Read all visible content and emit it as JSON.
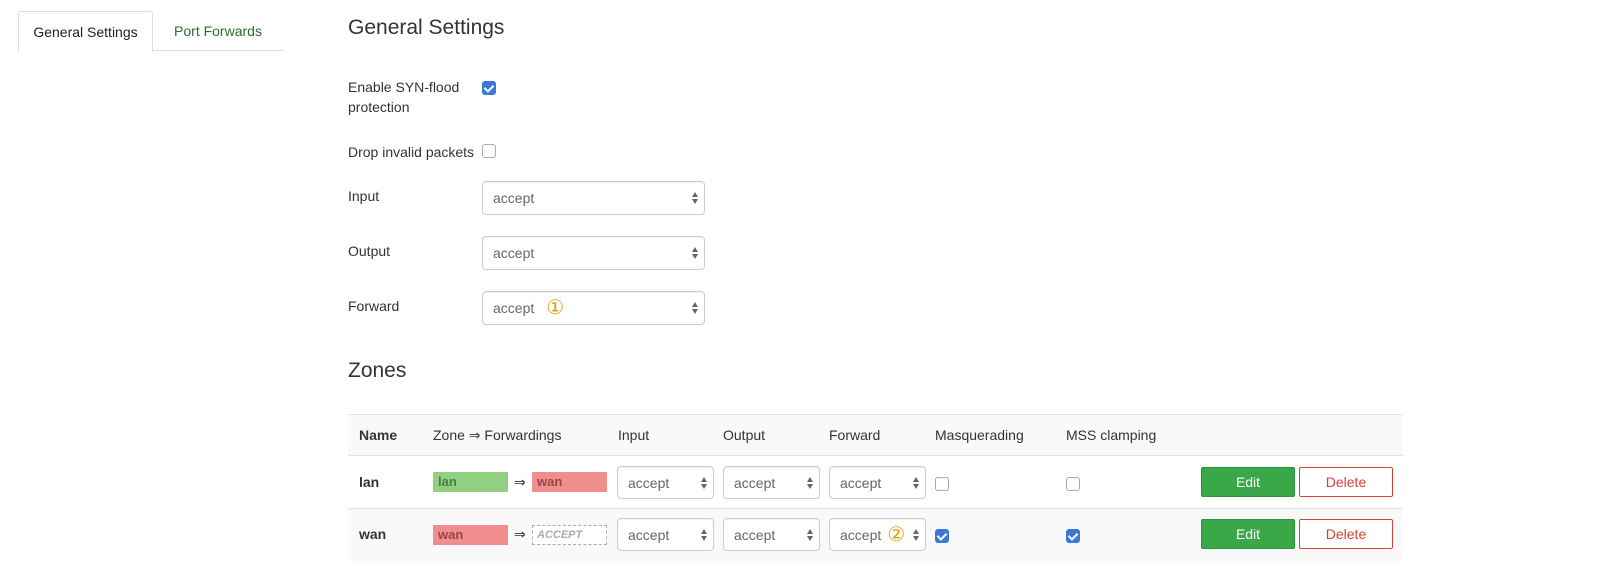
{
  "tabs": [
    {
      "label": "General Settings",
      "active": true
    },
    {
      "label": "Port Forwards",
      "active": false
    }
  ],
  "general": {
    "title": "General Settings",
    "syn_flood_label_line1": "Enable SYN-flood",
    "syn_flood_label_line2": "protection",
    "syn_flood_checked": true,
    "drop_invalid_label": "Drop invalid packets",
    "drop_invalid_checked": false,
    "input_label": "Input",
    "input_value": "accept",
    "output_label": "Output",
    "output_value": "accept",
    "forward_label": "Forward",
    "forward_value": "accept",
    "forward_marker": "①"
  },
  "zones": {
    "title": "Zones",
    "headers": {
      "name": "Name",
      "forwardings": "Zone ⇒ Forwardings",
      "input": "Input",
      "output": "Output",
      "forward": "Forward",
      "masquerading": "Masquerading",
      "mss": "MSS clamping"
    },
    "rows": [
      {
        "name": "lan",
        "zone": "lan",
        "arrow": "⇒",
        "dest": "wan",
        "input": "accept",
        "output": "accept",
        "forward": "accept",
        "forward_marker": "",
        "masquerading": false,
        "mss": false,
        "edit": "Edit",
        "delete": "Delete"
      },
      {
        "name": "wan",
        "zone": "wan",
        "arrow": "⇒",
        "dest": "ACCEPT",
        "input": "accept",
        "output": "accept",
        "forward": "accept",
        "forward_marker": "②",
        "masquerading": true,
        "mss": true,
        "edit": "Edit",
        "delete": "Delete"
      }
    ]
  },
  "colors": {
    "accent_green": "#3aa748",
    "delete_red": "#d9403a",
    "checkbox_blue": "#3b78d8",
    "zone_lan": "#90d080",
    "zone_wan": "#f08d8d",
    "marker": "#e89a0c"
  }
}
